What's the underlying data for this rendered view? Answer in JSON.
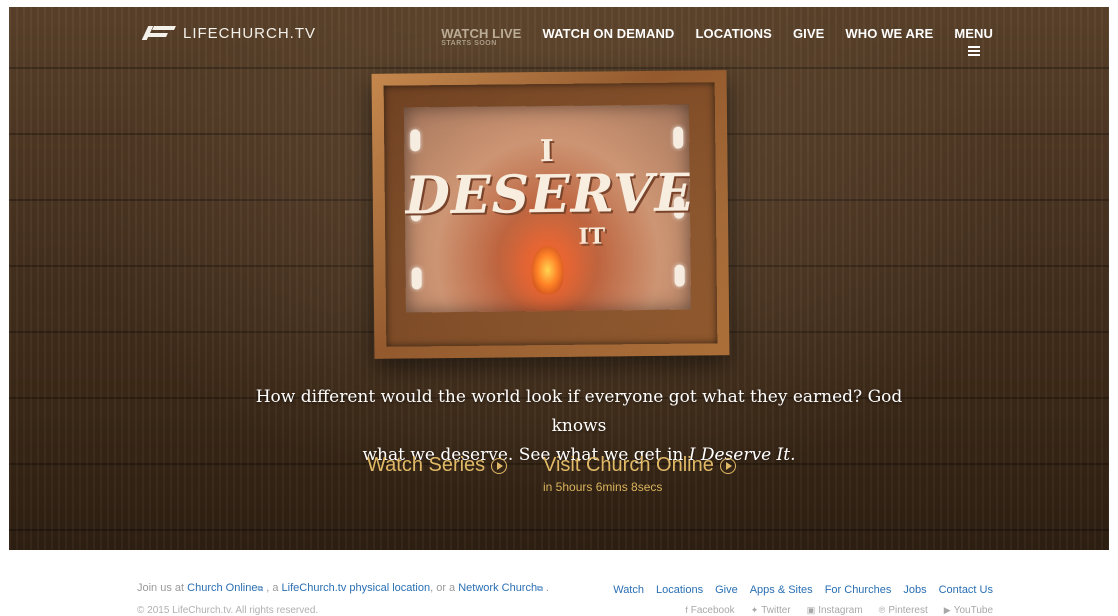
{
  "header": {
    "logo_text": "LIFECHURCH.TV",
    "nav": {
      "watch_live": "WATCH LIVE",
      "watch_live_sub": "STARTS SOON",
      "watch_on_demand": "WATCH ON DEMAND",
      "locations": "LOCATIONS",
      "give": "GIVE",
      "who_we_are": "WHO WE ARE",
      "menu": "MENU"
    }
  },
  "hero": {
    "artwork": {
      "line1": "I",
      "line2": "DESERVE",
      "line3": "IT"
    },
    "tagline_line1": "How different would the world look if everyone got what they earned? God knows",
    "tagline_line2_prefix": "what we deserve. See what we get in ",
    "tagline_line2_title": "I Deserve It.",
    "watch_series": "Watch Series",
    "visit_church_online": "Visit Church Online",
    "countdown": "in 5hours 6mins 8secs"
  },
  "footer": {
    "join_prefix": "Join us at ",
    "church_online": "Church Online",
    "sep1": " , a ",
    "physical_location": "LifeChurch.tv physical location",
    "sep2": ", or a ",
    "network_church": "Network Church",
    "end": " .",
    "copyright": "© 2015 LifeChurch.tv. All rights reserved.",
    "links": [
      "Watch",
      "Locations",
      "Give",
      "Apps & Sites",
      "For Churches",
      "Jobs",
      "Contact Us"
    ],
    "social": [
      "Facebook",
      "Twitter",
      "Instagram",
      "Pinterest",
      "YouTube"
    ]
  },
  "colors": {
    "accent_gold": "#e0b966",
    "link_blue": "#2a6fb3",
    "wood_dark": "#3c2918"
  }
}
